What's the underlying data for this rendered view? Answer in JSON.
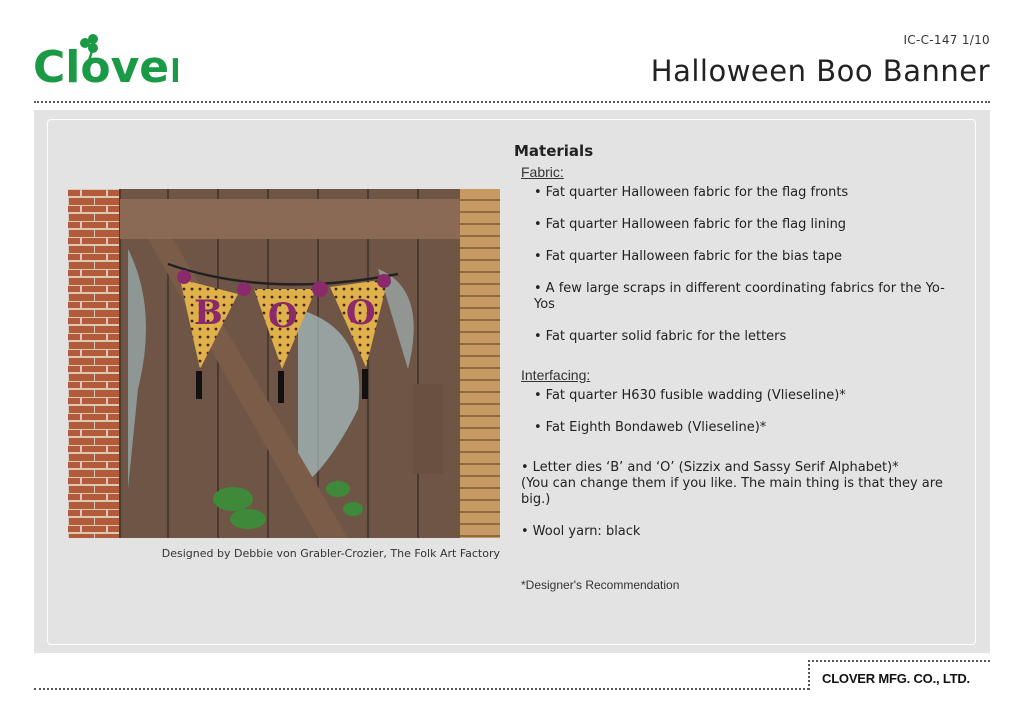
{
  "header": {
    "brand": "Clover",
    "doc_code": "IC-C-147  1/10",
    "title": "Halloween Boo Banner",
    "brand_color": "#1a9a45"
  },
  "photo": {
    "banner_letters": [
      "B",
      "O",
      "O"
    ],
    "credit": "Designed by Debbie von Grabler-Crozier, The Folk Art Factory"
  },
  "materials": {
    "heading": "Materials",
    "fabric_label": "Fabric:",
    "fabric_items": [
      "Fat quarter Halloween fabric for the flag fronts",
      "Fat quarter Halloween fabric for the flag lining",
      "Fat quarter Halloween fabric for the bias tape",
      "A few large scraps in different coordinating fabrics for the Yo-Yos",
      "Fat quarter solid fabric for the letters"
    ],
    "interfacing_label": "Interfacing:",
    "interfacing_items": [
      "Fat quarter H630 fusible wadding (Vlieseline)*",
      "Fat Eighth Bondaweb (Vlieseline)*"
    ],
    "dies_item": "Letter dies ‘B’ and ‘O’ (Sizzix and Sassy Serif Alphabet)*",
    "dies_note": "(You can change them if you like. The main thing is that they are big.)",
    "yarn_item": "Wool yarn: black",
    "recommendation": "*Designer's Recommendation"
  },
  "footer": {
    "company": "CLOVER MFG. CO., LTD."
  }
}
